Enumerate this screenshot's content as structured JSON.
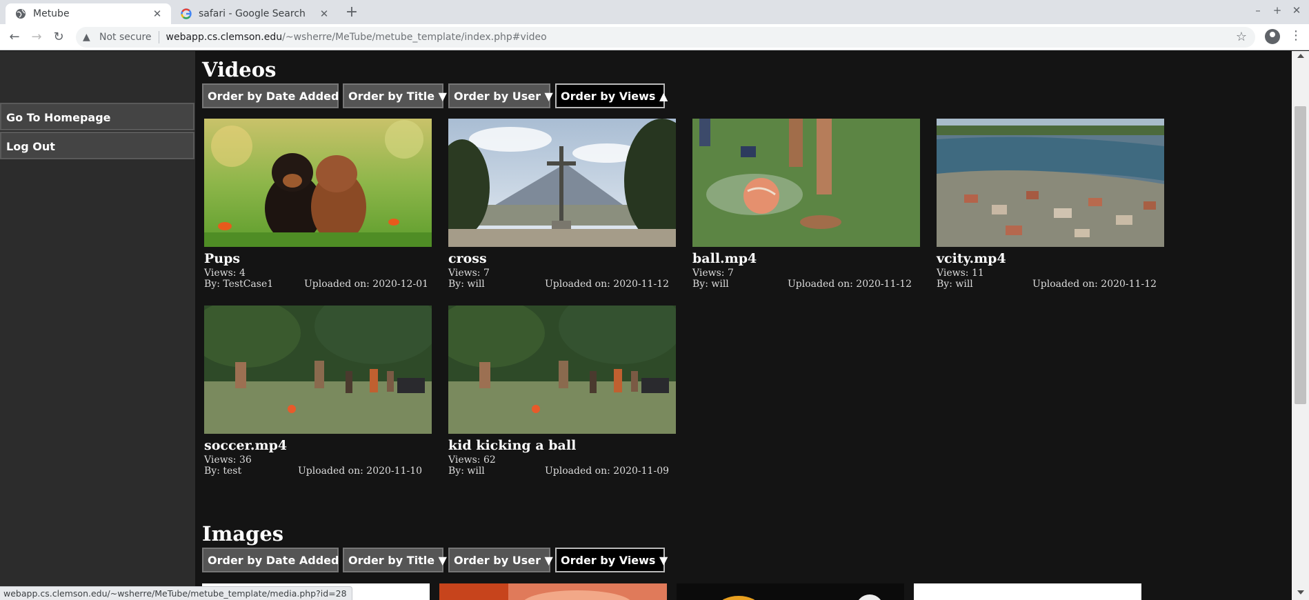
{
  "browser": {
    "tabs": [
      {
        "title": "Metube",
        "active": true
      },
      {
        "title": "safari - Google Search",
        "active": false
      }
    ],
    "security_label": "Not secure",
    "url_host": "webapp.cs.clemson.edu",
    "url_path": "/~wsherre/MeTube/metube_template/index.php#video",
    "status_url": "webapp.cs.clemson.edu/~wsherre/MeTube/metube_template/media.php?id=28"
  },
  "sidebar": {
    "items": [
      {
        "label": "Go To Homepage"
      },
      {
        "label": "Log Out"
      }
    ]
  },
  "videos": {
    "heading": "Videos",
    "sort_buttons": [
      {
        "label": "Order by Date Added ▼"
      },
      {
        "label": "Order by Title ▼"
      },
      {
        "label": "Order by User ▼"
      },
      {
        "label": "Order by Views ▲",
        "active": true
      }
    ],
    "items": [
      {
        "title": "Pups",
        "views": "Views: 4",
        "by": "By: TestCase1",
        "uploaded": "Uploaded on: 2020-12-01"
      },
      {
        "title": "cross",
        "views": "Views: 7",
        "by": "By: will",
        "uploaded": "Uploaded on: 2020-11-12"
      },
      {
        "title": "ball.mp4",
        "views": "Views: 7",
        "by": "By: will",
        "uploaded": "Uploaded on: 2020-11-12"
      },
      {
        "title": "vcity.mp4",
        "views": "Views: 11",
        "by": "By: will",
        "uploaded": "Uploaded on: 2020-11-12"
      },
      {
        "title": "soccer.mp4",
        "views": "Views: 36",
        "by": "By: test",
        "uploaded": "Uploaded on: 2020-11-10"
      },
      {
        "title": "kid kicking a ball",
        "views": "Views: 62",
        "by": "By: will",
        "uploaded": "Uploaded on: 2020-11-09"
      }
    ]
  },
  "images": {
    "heading": "Images",
    "sort_buttons": [
      {
        "label": "Order by Date Added ▼"
      },
      {
        "label": "Order by Title ▼"
      },
      {
        "label": "Order by User ▼"
      },
      {
        "label": "Order by Views ▼",
        "active": true
      }
    ]
  }
}
